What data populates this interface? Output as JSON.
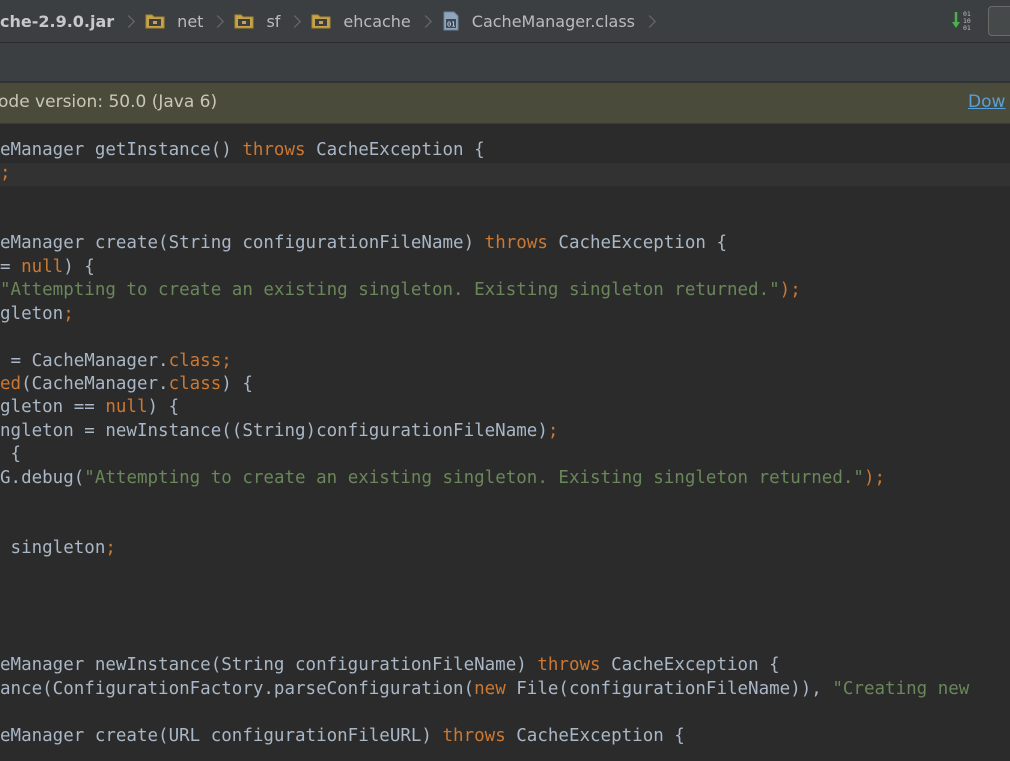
{
  "breadcrumb": {
    "items": [
      {
        "label": "che-2.9.0.jar",
        "icon": "jar-icon"
      },
      {
        "label": "net",
        "icon": "package-folder-icon"
      },
      {
        "label": "sf",
        "icon": "package-folder-icon"
      },
      {
        "label": "ehcache",
        "icon": "package-folder-icon"
      },
      {
        "label": "CacheManager.class",
        "icon": "class-file-icon"
      }
    ]
  },
  "toolbar": {
    "sort_icon": "sort-numeric-icon",
    "window_icon": "window-restore-icon"
  },
  "banner": {
    "text": "ode version: 50.0 (Java 6)",
    "link_label": "Dow"
  },
  "colors": {
    "keyword": "#cc7832",
    "string": "#6a8759",
    "identifier": "#a9b7c6",
    "background": "#2b2b2b",
    "banner": "#4b4b3c",
    "link": "#5a9fd6"
  },
  "code": {
    "lines": [
      [
        {
          "t": "eManager getInstance() ",
          "c": "plain"
        },
        {
          "t": "throws",
          "c": "kw"
        },
        {
          "t": " CacheException {",
          "c": "plain"
        }
      ],
      [
        {
          "t": ";",
          "c": "kw"
        }
      ],
      [],
      [],
      [
        {
          "t": "eManager create(String configurationFileName) ",
          "c": "plain"
        },
        {
          "t": "throws",
          "c": "kw"
        },
        {
          "t": " CacheException {",
          "c": "plain"
        }
      ],
      [
        {
          "t": "= ",
          "c": "plain"
        },
        {
          "t": "null",
          "c": "kw"
        },
        {
          "t": ") {",
          "c": "plain"
        }
      ],
      [
        {
          "t": "\"Attempting to create an existing singleton. Existing singleton returned.\"",
          "c": "str"
        },
        {
          "t": ");",
          "c": "kw"
        }
      ],
      [
        {
          "t": "gleton",
          "c": "plain"
        },
        {
          "t": ";",
          "c": "kw"
        }
      ],
      [],
      [
        {
          "t": " = CacheManager.",
          "c": "plain"
        },
        {
          "t": "class;",
          "c": "kw"
        }
      ],
      [
        {
          "t": "ed",
          "c": "kw"
        },
        {
          "t": "(CacheManager.",
          "c": "plain"
        },
        {
          "t": "class",
          "c": "kw"
        },
        {
          "t": ") {",
          "c": "plain"
        }
      ],
      [
        {
          "t": "gleton == ",
          "c": "plain"
        },
        {
          "t": "null",
          "c": "kw"
        },
        {
          "t": ") {",
          "c": "plain"
        }
      ],
      [
        {
          "t": "ngleton = newInstance((String)configurationFileName)",
          "c": "plain"
        },
        {
          "t": ";",
          "c": "kw"
        }
      ],
      [
        {
          "t": " {",
          "c": "plain"
        }
      ],
      [
        {
          "t": "G.debug(",
          "c": "plain"
        },
        {
          "t": "\"Attempting to create an existing singleton. Existing singleton returned.\"",
          "c": "str"
        },
        {
          "t": ");",
          "c": "kw"
        }
      ],
      [],
      [],
      [
        {
          "t": " singleton",
          "c": "plain"
        },
        {
          "t": ";",
          "c": "kw"
        }
      ],
      [],
      [],
      [],
      [],
      [
        {
          "t": "eManager newInstance(String configurationFileName) ",
          "c": "plain"
        },
        {
          "t": "throws",
          "c": "kw"
        },
        {
          "t": " CacheException {",
          "c": "plain"
        }
      ],
      [
        {
          "t": "ance(ConfigurationFactory.parseConfiguration(",
          "c": "plain"
        },
        {
          "t": "new",
          "c": "kw"
        },
        {
          "t": " File(configurationFileName)), ",
          "c": "plain"
        },
        {
          "t": "\"Creating new",
          "c": "str"
        }
      ],
      [],
      [
        {
          "t": "eManager create(URL configurationFileURL) ",
          "c": "plain"
        },
        {
          "t": "throws",
          "c": "kw"
        },
        {
          "t": " CacheException {",
          "c": "plain"
        }
      ]
    ]
  }
}
